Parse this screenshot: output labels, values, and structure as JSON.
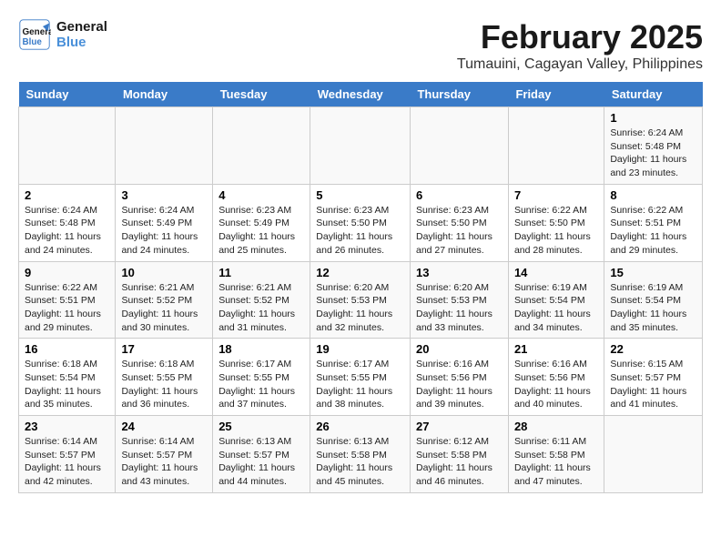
{
  "header": {
    "logo_line1": "General",
    "logo_line2": "Blue",
    "month": "February 2025",
    "location": "Tumauini, Cagayan Valley, Philippines"
  },
  "weekdays": [
    "Sunday",
    "Monday",
    "Tuesday",
    "Wednesday",
    "Thursday",
    "Friday",
    "Saturday"
  ],
  "weeks": [
    [
      {
        "day": "",
        "info": ""
      },
      {
        "day": "",
        "info": ""
      },
      {
        "day": "",
        "info": ""
      },
      {
        "day": "",
        "info": ""
      },
      {
        "day": "",
        "info": ""
      },
      {
        "day": "",
        "info": ""
      },
      {
        "day": "1",
        "info": "Sunrise: 6:24 AM\nSunset: 5:48 PM\nDaylight: 11 hours and 23 minutes."
      }
    ],
    [
      {
        "day": "2",
        "info": "Sunrise: 6:24 AM\nSunset: 5:48 PM\nDaylight: 11 hours and 24 minutes."
      },
      {
        "day": "3",
        "info": "Sunrise: 6:24 AM\nSunset: 5:49 PM\nDaylight: 11 hours and 24 minutes."
      },
      {
        "day": "4",
        "info": "Sunrise: 6:23 AM\nSunset: 5:49 PM\nDaylight: 11 hours and 25 minutes."
      },
      {
        "day": "5",
        "info": "Sunrise: 6:23 AM\nSunset: 5:50 PM\nDaylight: 11 hours and 26 minutes."
      },
      {
        "day": "6",
        "info": "Sunrise: 6:23 AM\nSunset: 5:50 PM\nDaylight: 11 hours and 27 minutes."
      },
      {
        "day": "7",
        "info": "Sunrise: 6:22 AM\nSunset: 5:50 PM\nDaylight: 11 hours and 28 minutes."
      },
      {
        "day": "8",
        "info": "Sunrise: 6:22 AM\nSunset: 5:51 PM\nDaylight: 11 hours and 29 minutes."
      }
    ],
    [
      {
        "day": "9",
        "info": "Sunrise: 6:22 AM\nSunset: 5:51 PM\nDaylight: 11 hours and 29 minutes."
      },
      {
        "day": "10",
        "info": "Sunrise: 6:21 AM\nSunset: 5:52 PM\nDaylight: 11 hours and 30 minutes."
      },
      {
        "day": "11",
        "info": "Sunrise: 6:21 AM\nSunset: 5:52 PM\nDaylight: 11 hours and 31 minutes."
      },
      {
        "day": "12",
        "info": "Sunrise: 6:20 AM\nSunset: 5:53 PM\nDaylight: 11 hours and 32 minutes."
      },
      {
        "day": "13",
        "info": "Sunrise: 6:20 AM\nSunset: 5:53 PM\nDaylight: 11 hours and 33 minutes."
      },
      {
        "day": "14",
        "info": "Sunrise: 6:19 AM\nSunset: 5:54 PM\nDaylight: 11 hours and 34 minutes."
      },
      {
        "day": "15",
        "info": "Sunrise: 6:19 AM\nSunset: 5:54 PM\nDaylight: 11 hours and 35 minutes."
      }
    ],
    [
      {
        "day": "16",
        "info": "Sunrise: 6:18 AM\nSunset: 5:54 PM\nDaylight: 11 hours and 35 minutes."
      },
      {
        "day": "17",
        "info": "Sunrise: 6:18 AM\nSunset: 5:55 PM\nDaylight: 11 hours and 36 minutes."
      },
      {
        "day": "18",
        "info": "Sunrise: 6:17 AM\nSunset: 5:55 PM\nDaylight: 11 hours and 37 minutes."
      },
      {
        "day": "19",
        "info": "Sunrise: 6:17 AM\nSunset: 5:55 PM\nDaylight: 11 hours and 38 minutes."
      },
      {
        "day": "20",
        "info": "Sunrise: 6:16 AM\nSunset: 5:56 PM\nDaylight: 11 hours and 39 minutes."
      },
      {
        "day": "21",
        "info": "Sunrise: 6:16 AM\nSunset: 5:56 PM\nDaylight: 11 hours and 40 minutes."
      },
      {
        "day": "22",
        "info": "Sunrise: 6:15 AM\nSunset: 5:57 PM\nDaylight: 11 hours and 41 minutes."
      }
    ],
    [
      {
        "day": "23",
        "info": "Sunrise: 6:14 AM\nSunset: 5:57 PM\nDaylight: 11 hours and 42 minutes."
      },
      {
        "day": "24",
        "info": "Sunrise: 6:14 AM\nSunset: 5:57 PM\nDaylight: 11 hours and 43 minutes."
      },
      {
        "day": "25",
        "info": "Sunrise: 6:13 AM\nSunset: 5:57 PM\nDaylight: 11 hours and 44 minutes."
      },
      {
        "day": "26",
        "info": "Sunrise: 6:13 AM\nSunset: 5:58 PM\nDaylight: 11 hours and 45 minutes."
      },
      {
        "day": "27",
        "info": "Sunrise: 6:12 AM\nSunset: 5:58 PM\nDaylight: 11 hours and 46 minutes."
      },
      {
        "day": "28",
        "info": "Sunrise: 6:11 AM\nSunset: 5:58 PM\nDaylight: 11 hours and 47 minutes."
      },
      {
        "day": "",
        "info": ""
      }
    ]
  ]
}
